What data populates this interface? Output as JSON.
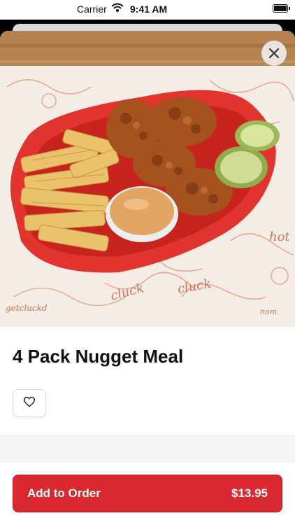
{
  "status_bar": {
    "carrier": "Carrier",
    "time": "9:41 AM"
  },
  "item": {
    "name": "4 Pack Nugget Meal"
  },
  "action": {
    "label": "Add to Order",
    "price": "$13.95"
  },
  "colors": {
    "accent": "#d9282f",
    "basket": "#e2342e"
  },
  "icons": {
    "close": "close-icon",
    "favorite": "heart-outline-icon"
  }
}
